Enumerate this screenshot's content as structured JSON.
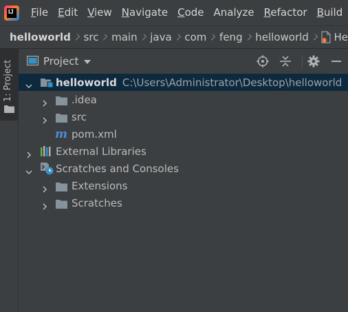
{
  "menubar": {
    "items": [
      {
        "mnemonic": "F",
        "rest": "ile"
      },
      {
        "mnemonic": "E",
        "rest": "dit"
      },
      {
        "mnemonic": "V",
        "rest": "iew"
      },
      {
        "mnemonic": "N",
        "rest": "avigate"
      },
      {
        "mnemonic": "C",
        "rest": "ode"
      },
      {
        "mnemonic": "",
        "rest": "Analyze"
      },
      {
        "mnemonic": "R",
        "rest": "efactor"
      },
      {
        "mnemonic": "B",
        "rest": "uild"
      }
    ]
  },
  "breadcrumb": {
    "items": [
      "helloworld",
      "src",
      "main",
      "java",
      "com",
      "feng",
      "helloworld"
    ],
    "file": "He"
  },
  "toolstripe": {
    "tab_label": "1: Project"
  },
  "panel": {
    "title": "Project",
    "tools": [
      "locate-icon",
      "collapse-all-icon",
      "settings-gear-icon",
      "hide-minus-icon"
    ]
  },
  "tree": {
    "root": {
      "name": "helloworld",
      "path": "C:\\Users\\Administrator\\Desktop\\helloworld"
    },
    "idea": ".idea",
    "src": "src",
    "pom": "pom.xml",
    "external_libraries": "External Libraries",
    "scratches_and_consoles": "Scratches and Consoles",
    "extensions": "Extensions",
    "scratches": "Scratches"
  },
  "colors": {
    "background": "#2b2b2b",
    "panel": "#3c3f41",
    "selection": "#0d293e",
    "folder": "#87939a",
    "maven": "#4b8ed8"
  }
}
